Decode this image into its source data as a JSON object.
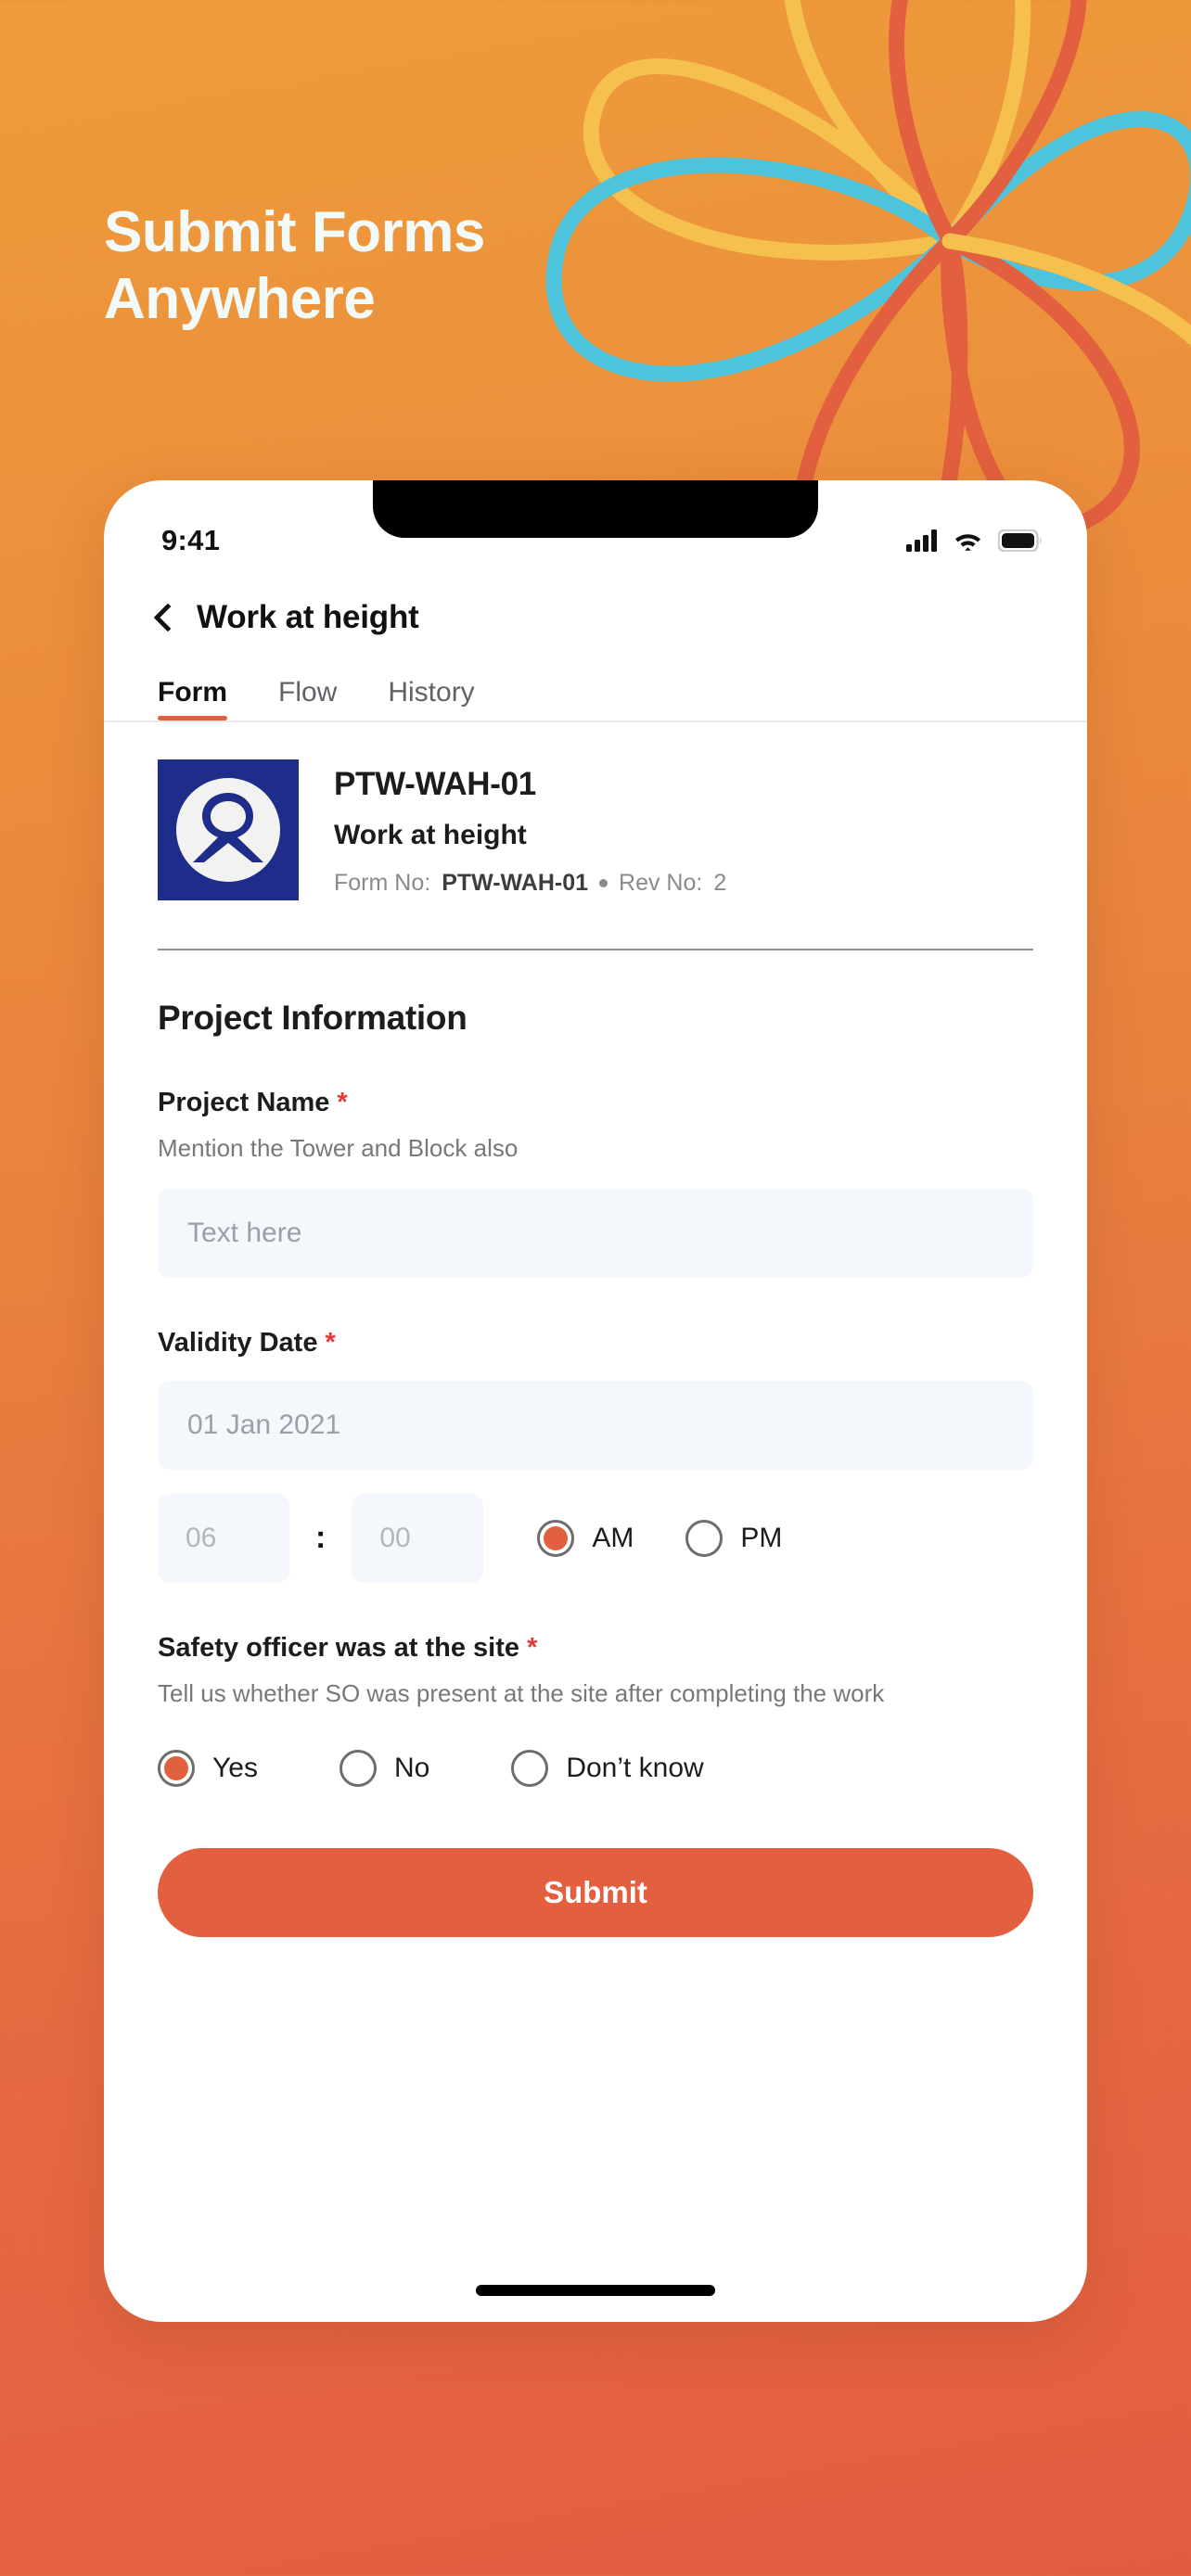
{
  "hero": {
    "headline_line1": "Submit Forms",
    "headline_line2": "Anywhere"
  },
  "colors": {
    "bg_top": "#EE9B3A",
    "bg_bottom": "#E25C42",
    "accent": "#E2603F",
    "petal_yellow": "#F5C04E",
    "petal_cyan": "#4EC3DC",
    "petal_orange": "#E2603F",
    "logo_blue": "#1F2D8A",
    "required_red": "#E53935",
    "input_bg": "#F4F7FC"
  },
  "statusbar": {
    "time": "9:41",
    "icons": [
      "signal-icon",
      "wifi-icon",
      "battery-icon"
    ]
  },
  "navbar": {
    "back_icon": "chevron-left-icon",
    "title": "Work at height"
  },
  "tabs": [
    {
      "label": "Form",
      "active": true
    },
    {
      "label": "Flow",
      "active": false
    },
    {
      "label": "History",
      "active": false
    }
  ],
  "form_header": {
    "logo_icon": "company-ribbon-logo",
    "code": "PTW-WAH-01",
    "name": "Work at height",
    "form_no_label": "Form No:",
    "form_no_value": "PTW-WAH-01",
    "rev_no_label": "Rev No:",
    "rev_no_value": "2"
  },
  "section": {
    "title": "Project Information"
  },
  "fields": {
    "project_name": {
      "label": "Project Name",
      "required_mark": "*",
      "help": "Mention the Tower and Block also",
      "placeholder": "Text here",
      "value": ""
    },
    "validity_date": {
      "label": "Validity Date",
      "required_mark": "*",
      "placeholder": "01 Jan 2021",
      "value": "",
      "hour_placeholder": "06",
      "minute_placeholder": "00",
      "separator": ":",
      "meridiem_options": [
        {
          "label": "AM",
          "selected": true
        },
        {
          "label": "PM",
          "selected": false
        }
      ]
    },
    "safety_officer": {
      "label": "Safety officer was at the site",
      "required_mark": "*",
      "help": "Tell us whether SO was present at the site after completing the work",
      "options": [
        {
          "label": "Yes",
          "selected": true
        },
        {
          "label": "No",
          "selected": false
        },
        {
          "label": "Don’t know",
          "selected": false
        }
      ]
    }
  },
  "actions": {
    "submit_label": "Submit"
  }
}
